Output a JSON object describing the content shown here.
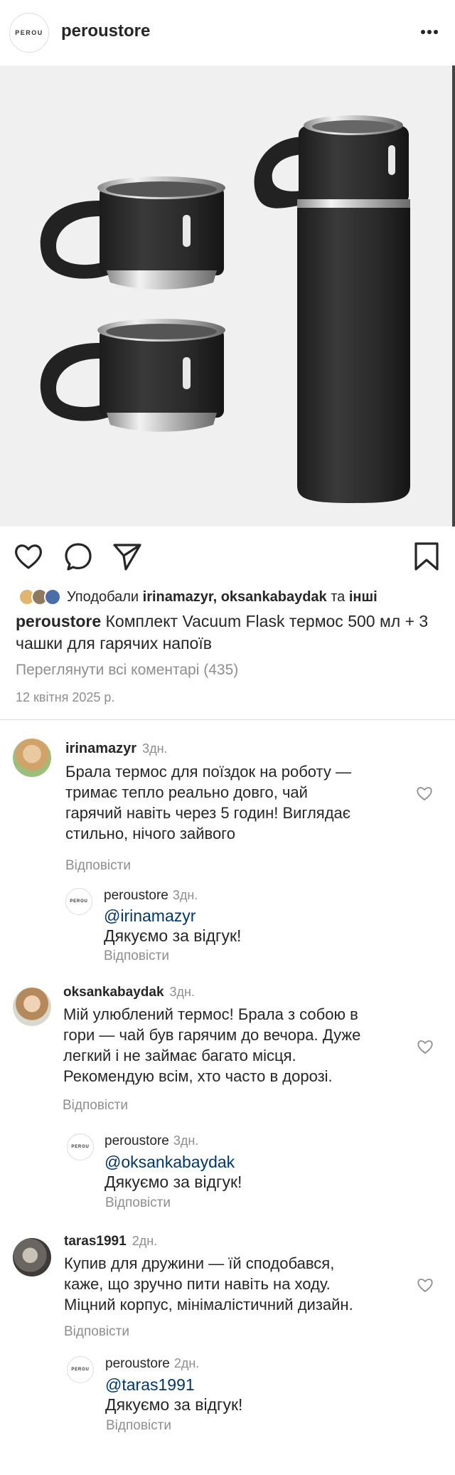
{
  "header": {
    "logo": "PEROU",
    "username": "peroustore"
  },
  "product_image": {
    "alt": "Vacuum Flask thermos with 3 cups"
  },
  "likes": {
    "prefix": "Уподобали",
    "users": "irinamazyr, oksankabaydak",
    "conjunction": "та",
    "others": "інші"
  },
  "caption": {
    "user": "peroustore",
    "text": "Комплект Vacuum Flask термос 500 мл + 3 чашки для гарячих напоїв"
  },
  "view_comments": "Переглянути всі коментарі (435)",
  "post_date": "12 квітня 2025 р.",
  "comments": [
    {
      "user": "irinamazyr",
      "time": "3дн.",
      "lines": [
        "Брала термос для поїздок на роботу —",
        "тримає тепло реально довго, чай",
        "гарячий навіть через 5 годин! Виглядає",
        "стильно, нічого зайвого"
      ],
      "reply_label": "Відповісти",
      "reply": {
        "user": "peroustore",
        "time": "3дн.",
        "mention": "@irinamazyr",
        "text": "Дякуємо за відгук!",
        "reply_label": "Відповісти"
      }
    },
    {
      "user": "oksankabaydak",
      "time": "3дн.",
      "lines": [
        "Мій улюблений термос! Брала з собою в",
        "гори — чай був гарячим до вечора. Дуже",
        "легкий і не займає багато місця.",
        "Рекомендую всім, хто часто в дорозі."
      ],
      "reply_label": "Відповісти",
      "reply": {
        "user": "peroustore",
        "time": "3дн.",
        "mention": "@oksankabaydak",
        "text": "Дякуємо за відгук!",
        "reply_label": "Відповісти"
      }
    },
    {
      "user": "taras1991",
      "time": "2дн.",
      "lines": [
        "Купив для дружини — їй сподобався,",
        "каже, що зручно пити навіть на ходу.",
        "Міцний корпус, мінімалістичний дизайн."
      ],
      "reply_label": "Відповісти",
      "reply": {
        "user": "peroustore",
        "time": "2дн.",
        "mention": "@taras1991",
        "text": "Дякуємо за відгук!",
        "reply_label": "Відповісти"
      }
    }
  ],
  "colors": {
    "text": "#262626",
    "muted": "#8e8e8e",
    "mention": "#00376b",
    "divider": "#dbdbdb"
  }
}
